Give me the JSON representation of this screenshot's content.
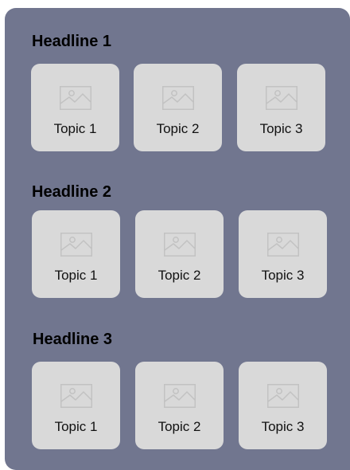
{
  "sections": [
    {
      "headline": "Headline 1",
      "topics": [
        {
          "label": "Topic 1",
          "icon": "image-placeholder-icon"
        },
        {
          "label": "Topic 2",
          "icon": "image-placeholder-icon"
        },
        {
          "label": "Topic 3",
          "icon": "image-placeholder-icon"
        }
      ]
    },
    {
      "headline": "Headline 2",
      "topics": [
        {
          "label": "Topic 1",
          "icon": "image-placeholder-icon"
        },
        {
          "label": "Topic 2",
          "icon": "image-placeholder-icon"
        },
        {
          "label": "Topic 3",
          "icon": "image-placeholder-icon"
        }
      ]
    },
    {
      "headline": "Headline 3",
      "topics": [
        {
          "label": "Topic 1",
          "icon": "image-placeholder-icon"
        },
        {
          "label": "Topic 2",
          "icon": "image-placeholder-icon"
        },
        {
          "label": "Topic 3",
          "icon": "image-placeholder-icon"
        }
      ]
    }
  ],
  "colors": {
    "panel_background": "#71768f",
    "card_background": "#d9d9d9",
    "placeholder_stroke": "#c2c2c2",
    "text": "#000000"
  }
}
